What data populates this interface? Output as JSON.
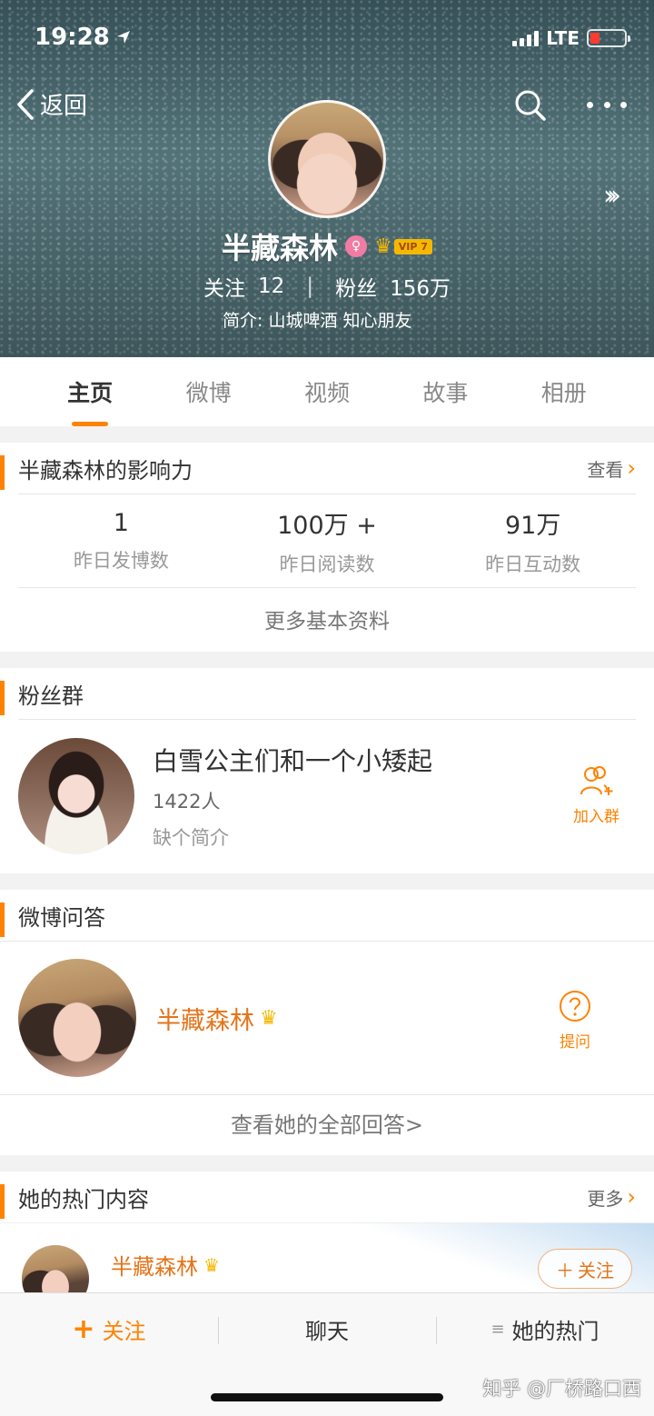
{
  "status_bar": {
    "time": "19:28",
    "network": "LTE"
  },
  "header": {
    "back_label": "返回",
    "name": "半藏森林",
    "vip_level": "VIP 7",
    "follow_label": "关注",
    "follow_count": "12",
    "fans_label": "粉丝",
    "fans_count": "156万",
    "bio": "简介: 山城啤酒 知心朋友"
  },
  "tabs": [
    "主页",
    "微博",
    "视频",
    "故事",
    "相册"
  ],
  "influence": {
    "title": "半藏森林的影响力",
    "link": "查看",
    "metrics": [
      {
        "value": "1",
        "label": "昨日发博数"
      },
      {
        "value": "100万 +",
        "label": "昨日阅读数"
      },
      {
        "value": "91万",
        "label": "昨日互动数"
      }
    ],
    "more": "更多基本资料"
  },
  "fan_group": {
    "title": "粉丝群",
    "name": "白雪公主们和一个小矮起",
    "count": "1422人",
    "desc": "缺个简介",
    "join_label": "加入群"
  },
  "qa": {
    "title": "微博问答",
    "name": "半藏森林",
    "ask_label": "提问",
    "all_label": "查看她的全部回答>"
  },
  "hot": {
    "title": "她的热门内容",
    "link": "更多",
    "name": "半藏森林",
    "follow_label": "关注"
  },
  "bottom_bar": {
    "follow": "关注",
    "chat": "聊天",
    "hot": "她的热门"
  },
  "watermark": "知乎 @厂桥路口西",
  "colors": {
    "accent": "#ff8200",
    "vip": "#f5b800",
    "name_orange": "#e5741a"
  }
}
